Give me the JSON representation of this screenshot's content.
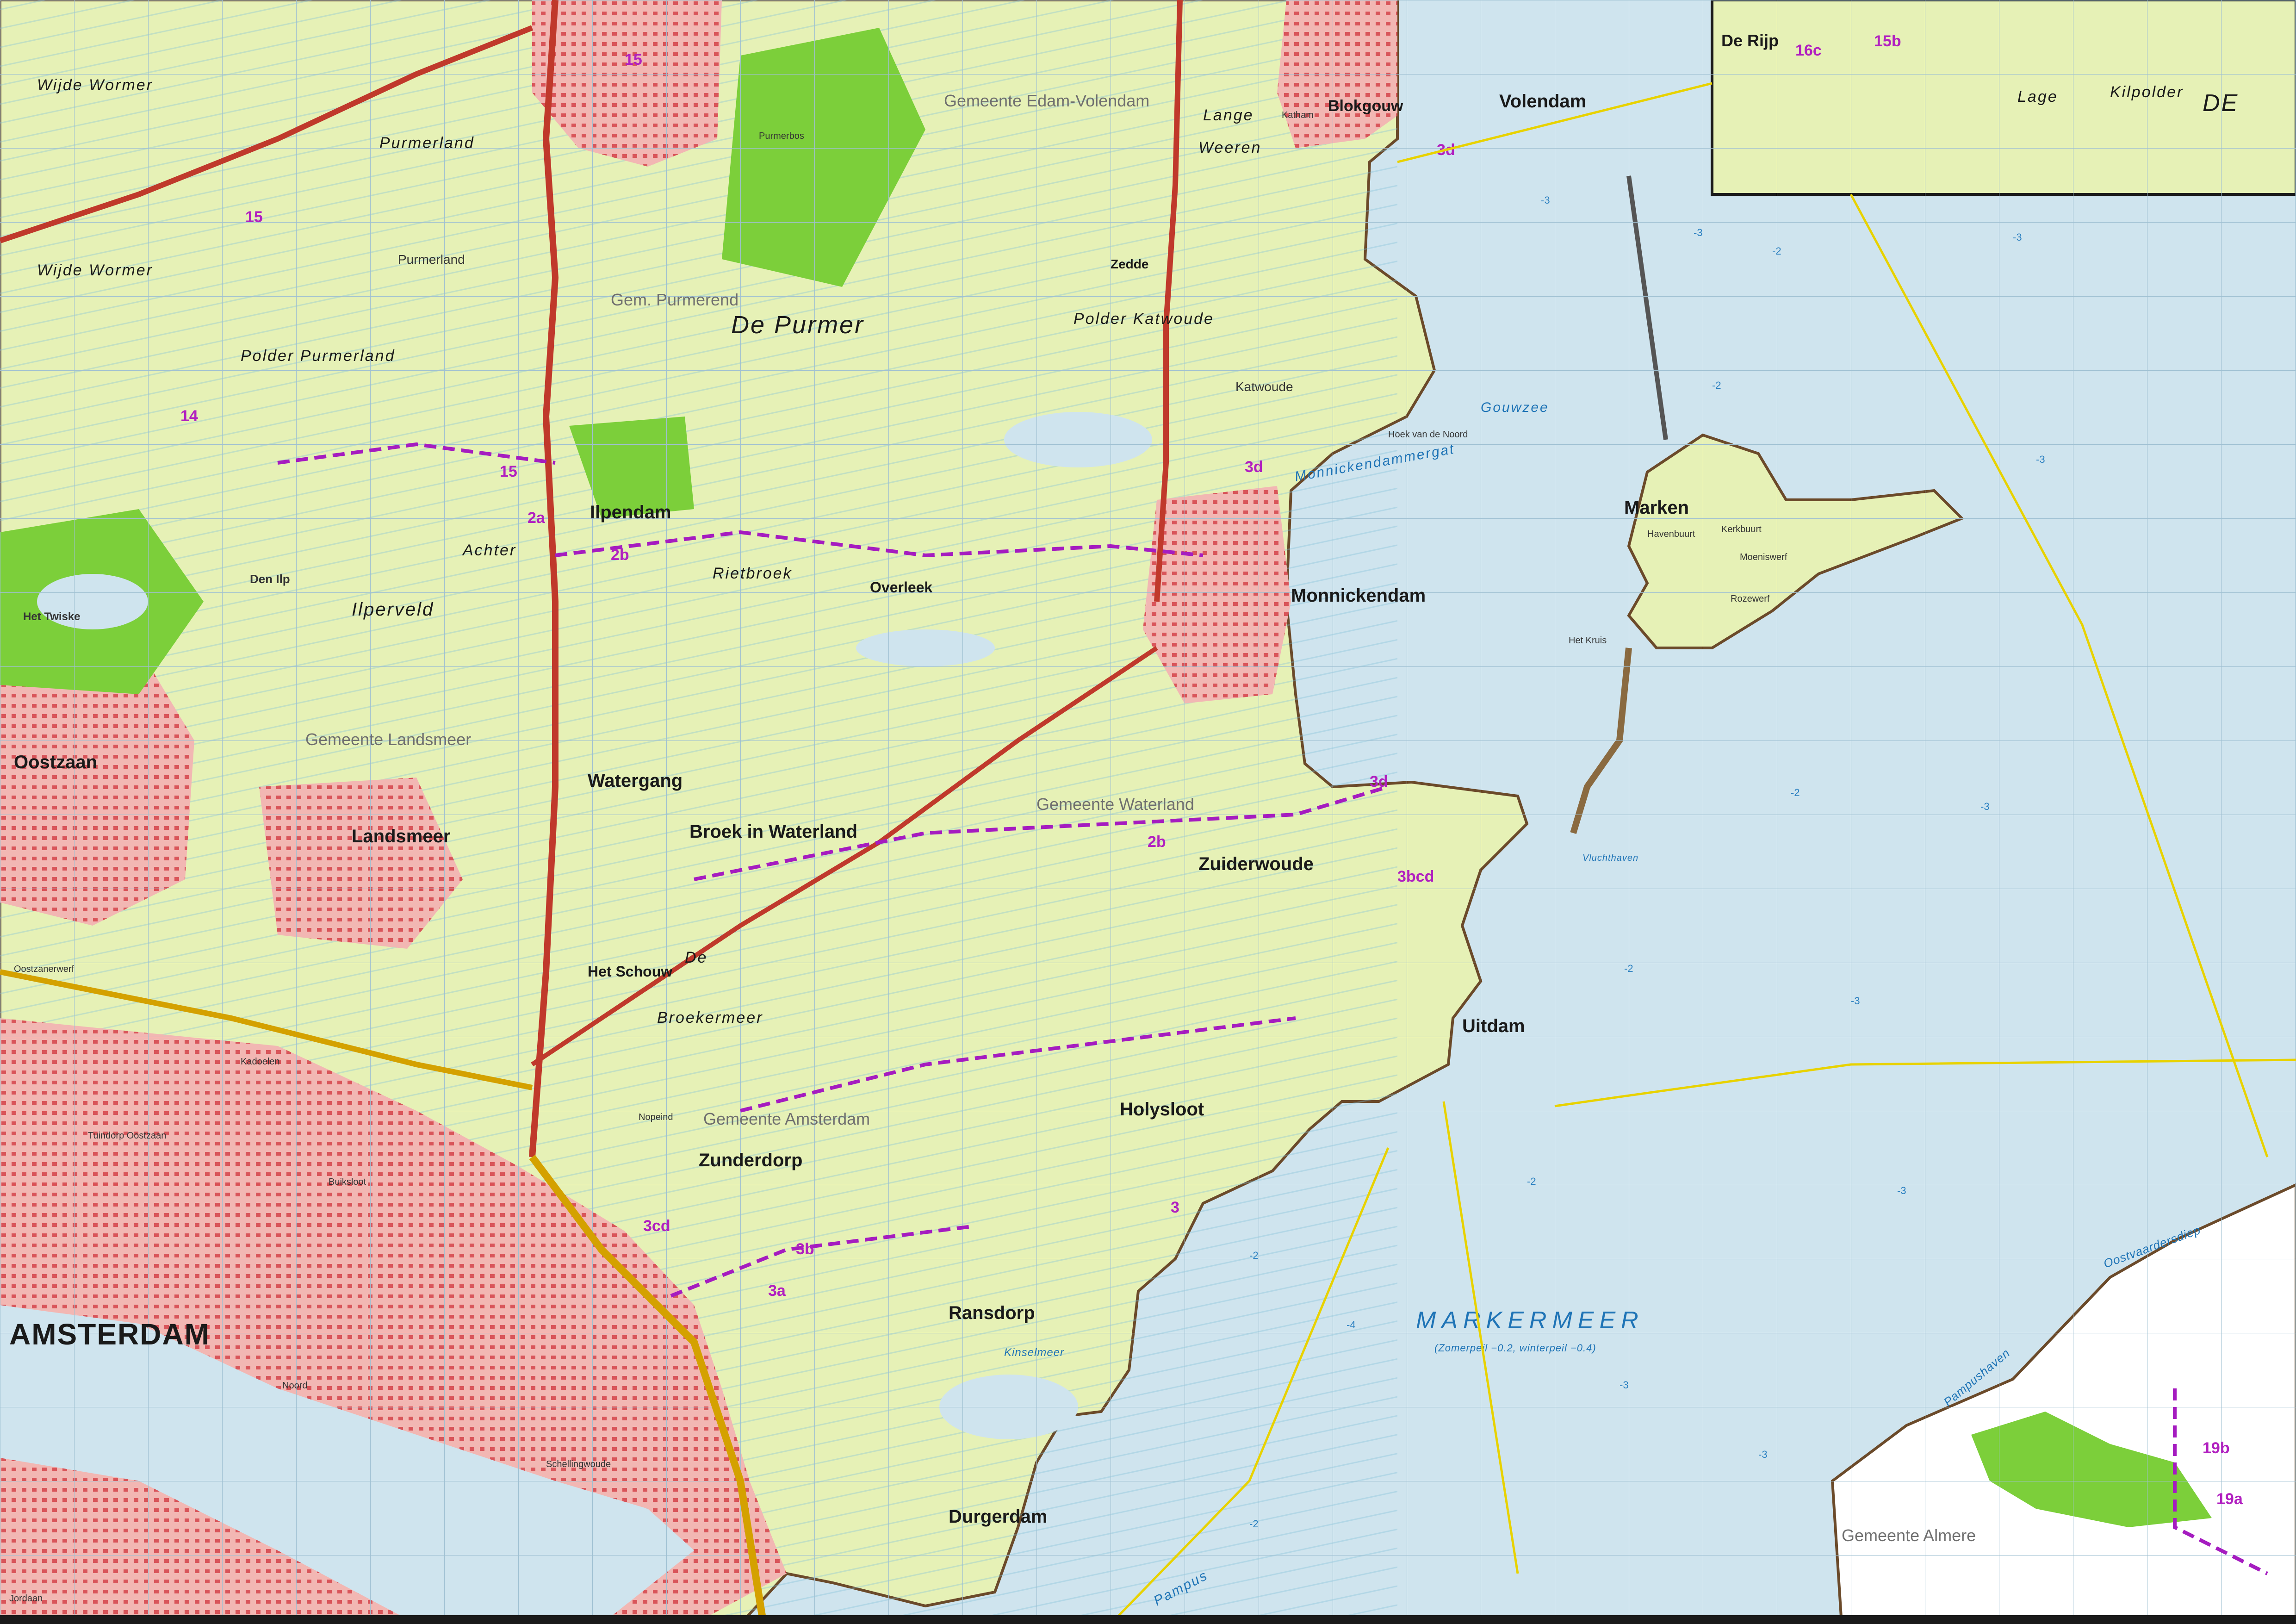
{
  "map": {
    "towns": [
      {
        "key": "volendam",
        "name": "Volendam"
      },
      {
        "key": "monnickendam",
        "name": "Monnickendam"
      },
      {
        "key": "marken",
        "name": "Marken"
      },
      {
        "key": "ilpendam",
        "name": "Ilpendam"
      },
      {
        "key": "landsmeer",
        "name": "Landsmeer"
      },
      {
        "key": "oostzaan",
        "name": "Oostzaan"
      },
      {
        "key": "broek",
        "name": "Broek in Waterland"
      },
      {
        "key": "zuiderwoude",
        "name": "Zuiderwoude"
      },
      {
        "key": "uitdam",
        "name": "Uitdam"
      },
      {
        "key": "holysloot",
        "name": "Holysloot"
      },
      {
        "key": "zunderdorp",
        "name": "Zunderdorp"
      },
      {
        "key": "ransdorp",
        "name": "Ransdorp"
      },
      {
        "key": "durgerdam",
        "name": "Durgerdam"
      },
      {
        "key": "watergang",
        "name": "Watergang"
      },
      {
        "key": "purmerland",
        "name": "Purmerland"
      },
      {
        "key": "katwoude",
        "name": "Katwoude"
      },
      {
        "key": "dijp",
        "name": "De Rijp"
      },
      {
        "key": "overleek",
        "name": "Overleek"
      },
      {
        "key": "zedde",
        "name": "Zedde"
      },
      {
        "key": "schouw",
        "name": "Het Schouw"
      },
      {
        "key": "blokgouw",
        "name": "Blokgouw"
      }
    ],
    "city": "AMSTERDAM",
    "polders": [
      {
        "key": "wijdewormer",
        "name": "Wijde   Wormer"
      },
      {
        "key": "wijdewormer2",
        "name": "Wijde   Wormer"
      },
      {
        "key": "purmerland",
        "name": "Purmerland"
      },
      {
        "key": "polderpurmerland",
        "name": "Polder   Purmerland"
      },
      {
        "key": "depurmer",
        "name": "De   Purmer"
      },
      {
        "key": "lange",
        "name": "Lange"
      },
      {
        "key": "weeren",
        "name": "Weeren"
      },
      {
        "key": "polderkatwoude",
        "name": "Polder   Katwoude"
      },
      {
        "key": "ilperveld",
        "name": "Ilperveld"
      },
      {
        "key": "achter",
        "name": "Achter"
      },
      {
        "key": "rietbroek",
        "name": "Rietbroek"
      },
      {
        "key": "broekermeer",
        "name": "Broekermeer"
      },
      {
        "key": "de",
        "name": "De"
      },
      {
        "key": "lage",
        "name": "Lage"
      },
      {
        "key": "kilpolder",
        "name": "Kilpolder"
      },
      {
        "key": "de2",
        "name": "DE"
      }
    ],
    "water": [
      {
        "key": "gouwzee",
        "name": "Gouwzee"
      },
      {
        "key": "monnickendammergat",
        "name": "Monnickendammergat"
      },
      {
        "key": "pampus",
        "name": "Pampus"
      }
    ],
    "markermeer": "MARKERMEER",
    "markermeer_note": "(Zomerpeil −0.2, winterpeil −0.4)",
    "municipalities": [
      {
        "key": "edam",
        "name": "Gemeente Edam-Volendam"
      },
      {
        "key": "purmerend",
        "name": "Gem. Purmerend"
      },
      {
        "key": "waterland",
        "name": "Gemeente Waterland"
      },
      {
        "key": "landsmeer",
        "name": "Gemeente Landsmeer"
      },
      {
        "key": "amsterdam",
        "name": "Gemeente Amsterdam"
      },
      {
        "key": "almere",
        "name": "Gemeente Almere"
      }
    ],
    "routes": [
      "3d",
      "3d",
      "3d",
      "2b",
      "2b",
      "2a",
      "3bcd",
      "3cd",
      "3b",
      "3a",
      "15",
      "15",
      "14",
      "15",
      "15b",
      "16c",
      "19b",
      "19a",
      "3"
    ],
    "places": [
      "Purmerbos",
      "Het Twiske",
      "Kadoelen",
      "Tuindorp Oostzaan",
      "Buiksloot",
      "Noord",
      "Schellingwoude",
      "Jordaan",
      "Katham",
      "Havenbuurt",
      "Kerkbuurt",
      "Rozewerf",
      "Moeniswerf",
      "Kinselmeer",
      "Oostvaardersdiep",
      "Pampushaven",
      "Hoek van de Noord",
      "Het Kruis",
      "Oostzanerwerf",
      "Den Ilp",
      "Nopeind",
      "Vluchthaven"
    ],
    "depths": [
      "-3",
      "-3",
      "-2",
      "-3",
      "-2",
      "-3",
      "-2",
      "-3",
      "-2",
      "-3",
      "-2",
      "-3",
      "-4",
      "-3",
      "-2",
      "-3",
      "-2"
    ]
  }
}
